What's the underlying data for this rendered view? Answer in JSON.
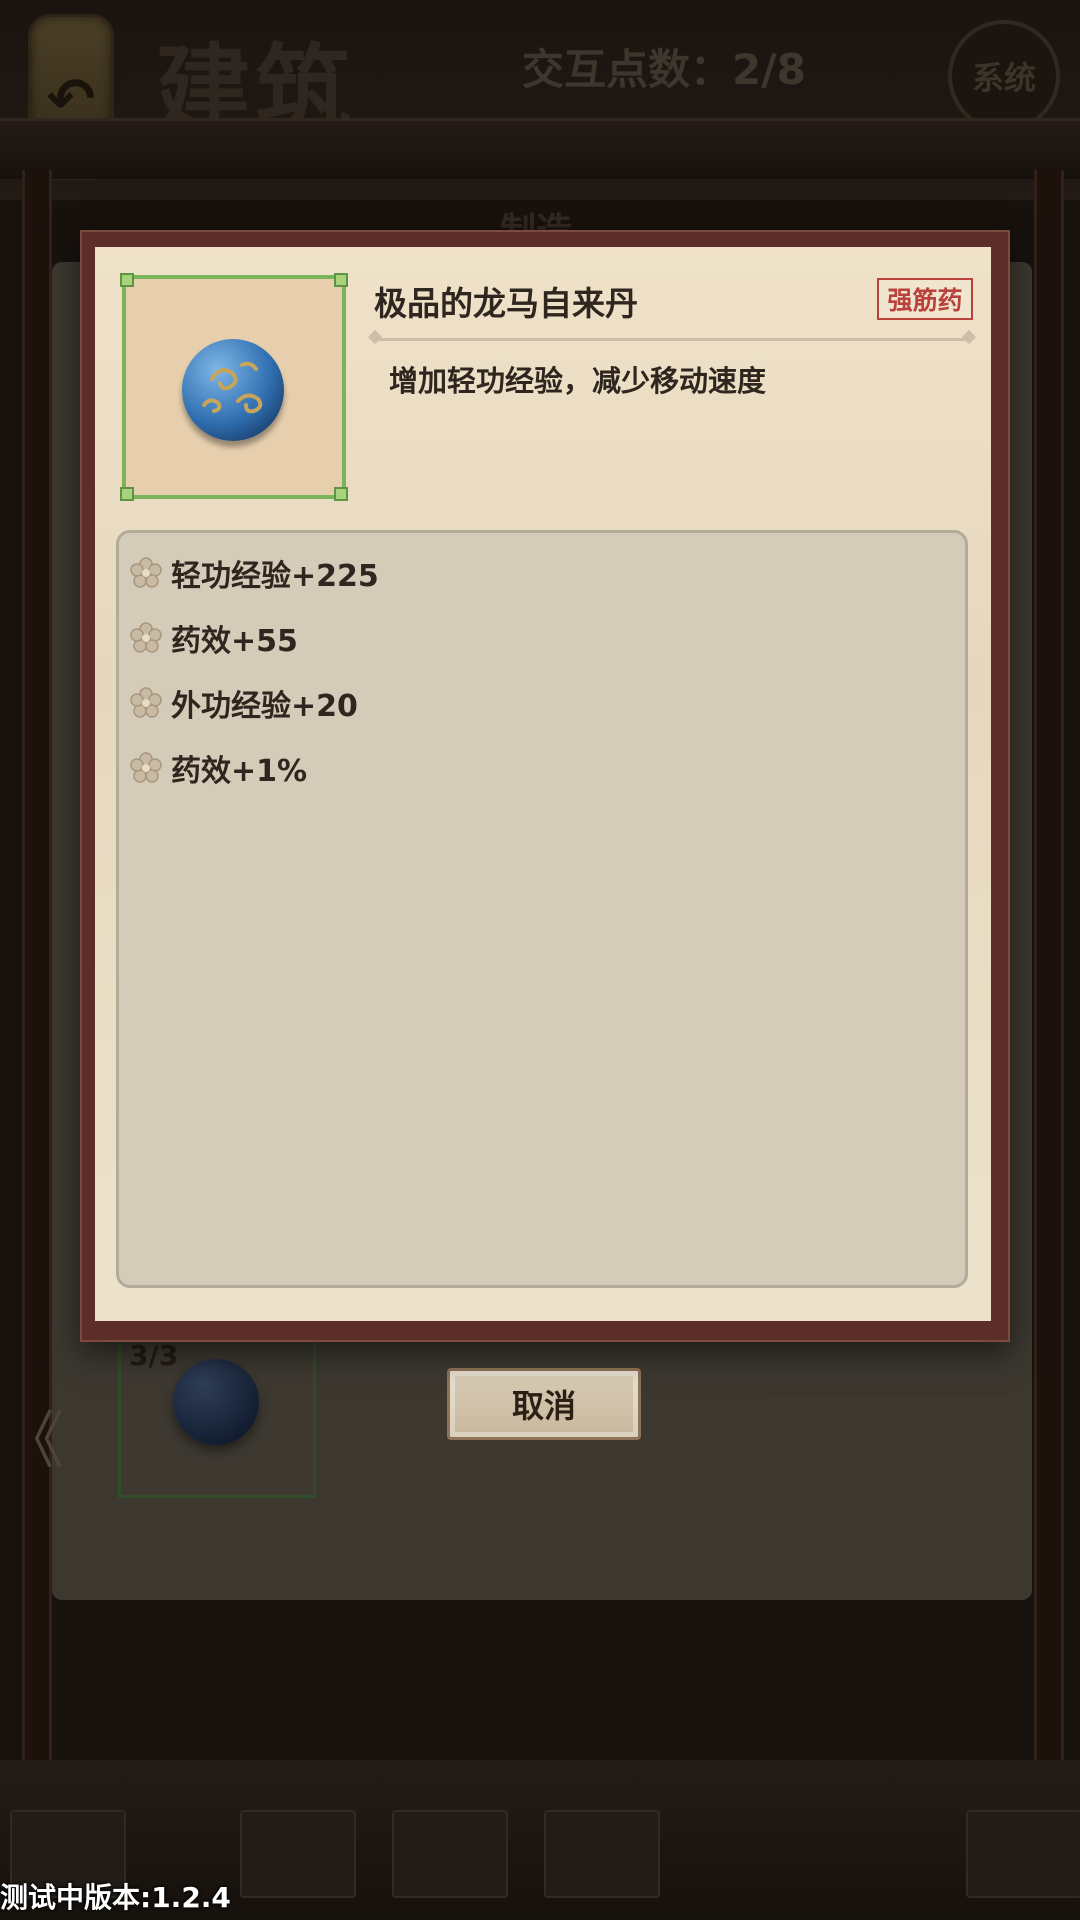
{
  "background": {
    "title": "建筑",
    "points_label": "交互点数：2/8",
    "system_button": "系统",
    "tab_label": "制造",
    "slot_count": "3/3",
    "cancel_label": "取消",
    "back_glyph": "↶",
    "left_arrow": "《"
  },
  "modal": {
    "item_name": "极品的龙马自来丹",
    "tag": "强筋药",
    "description": "增加轻功经验，减少移动速度",
    "stats": [
      {
        "label": "轻功经验+225"
      },
      {
        "label": "药效+55"
      },
      {
        "label": "外功经验+20"
      },
      {
        "label": "药效+1%"
      }
    ],
    "icons": {
      "item": "blue-pill-orb-icon",
      "bullet": "flower-icon"
    }
  },
  "footer": {
    "version": "测试中版本:1.2.4"
  },
  "colors": {
    "frame": "#5c2d29",
    "parchment": "#ece2cb",
    "tag_red": "#b9433c",
    "icon_border_green": "#79b35a"
  }
}
